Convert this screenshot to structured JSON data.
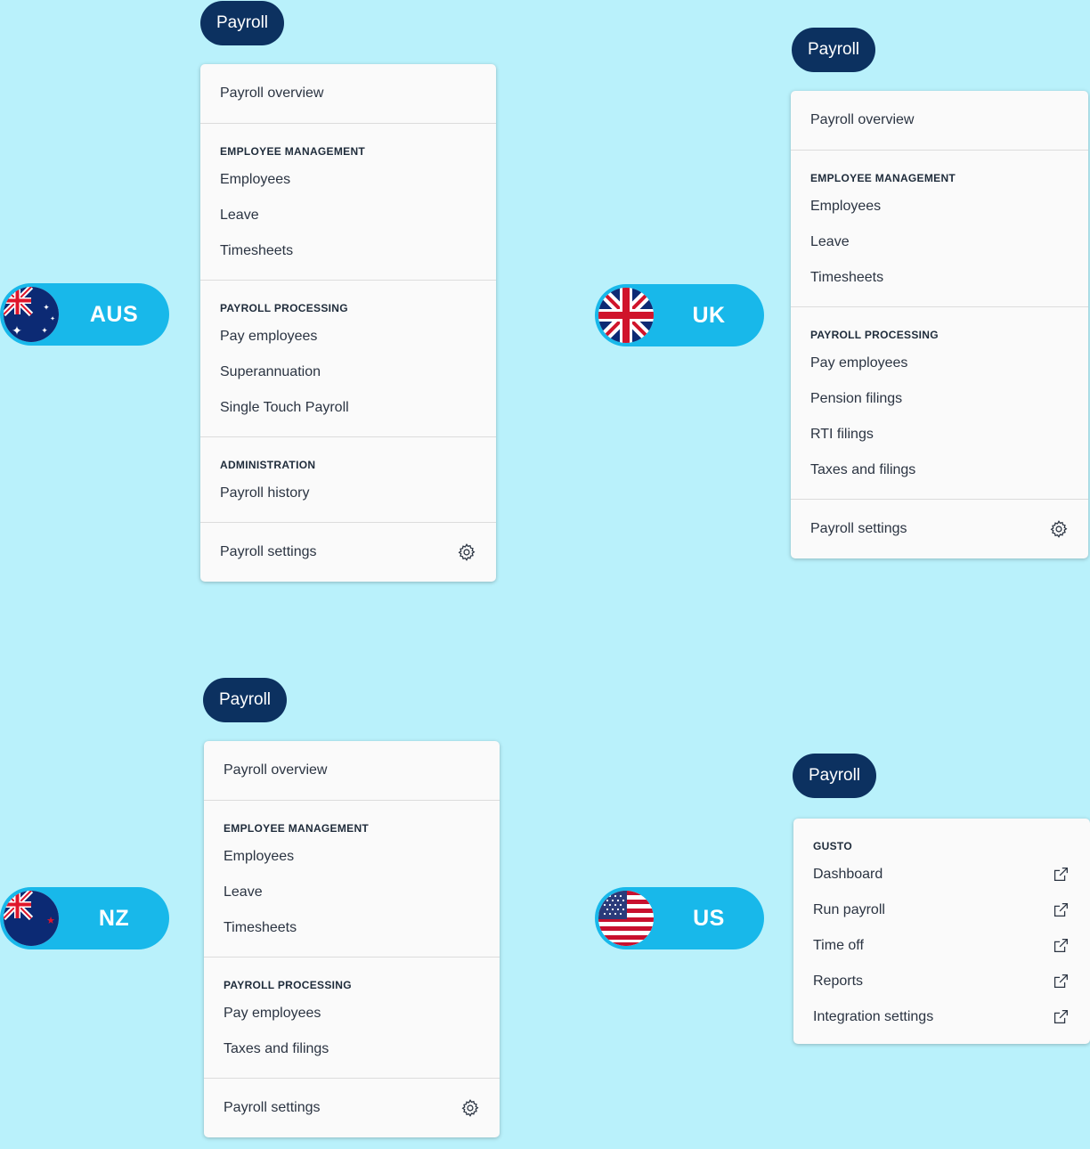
{
  "colors": {
    "background": "#b9f1fb",
    "pill_dark": "#0c3160",
    "pill_blue": "#18b8ea"
  },
  "aus": {
    "country": "AUS",
    "payroll_label": "Payroll",
    "overview": "Payroll overview",
    "employee_management": {
      "heading": "EMPLOYEE MANAGEMENT",
      "items": [
        "Employees",
        "Leave",
        "Timesheets"
      ]
    },
    "payroll_processing": {
      "heading": "PAYROLL PROCESSING",
      "items": [
        "Pay employees",
        "Superannuation",
        "Single Touch Payroll"
      ]
    },
    "administration": {
      "heading": "ADMINISTRATION",
      "items": [
        "Payroll history"
      ]
    },
    "settings": {
      "label": "Payroll settings",
      "icon": "gear-icon"
    }
  },
  "uk": {
    "country": "UK",
    "payroll_label": "Payroll",
    "overview": "Payroll overview",
    "employee_management": {
      "heading": "EMPLOYEE MANAGEMENT",
      "items": [
        "Employees",
        "Leave",
        "Timesheets"
      ]
    },
    "payroll_processing": {
      "heading": "PAYROLL PROCESSING",
      "items": [
        "Pay employees",
        "Pension filings",
        "RTI filings",
        "Taxes and filings"
      ]
    },
    "settings": {
      "label": "Payroll settings",
      "icon": "gear-icon"
    }
  },
  "nz": {
    "country": "NZ",
    "payroll_label": "Payroll",
    "overview": "Payroll overview",
    "employee_management": {
      "heading": "EMPLOYEE MANAGEMENT",
      "items": [
        "Employees",
        "Leave",
        "Timesheets"
      ]
    },
    "payroll_processing": {
      "heading": "PAYROLL PROCESSING",
      "items": [
        "Pay employees",
        "Taxes and filings"
      ]
    },
    "settings": {
      "label": "Payroll settings",
      "icon": "gear-icon"
    }
  },
  "us": {
    "country": "US",
    "payroll_label": "Payroll",
    "gusto": {
      "heading": "GUSTO",
      "items": [
        "Dashboard",
        "Run payroll",
        "Time off",
        "Reports",
        "Integration settings"
      ],
      "item_icon": "external-link-icon"
    }
  }
}
